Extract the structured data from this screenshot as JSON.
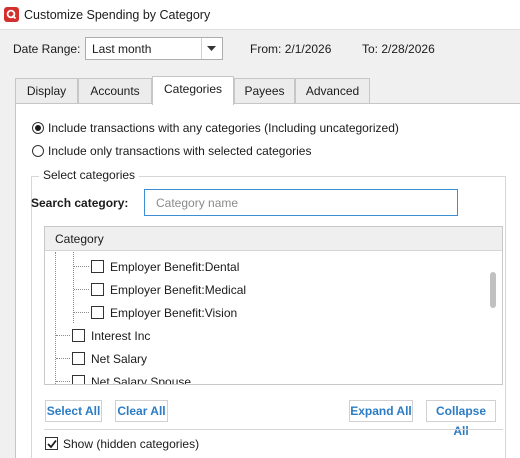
{
  "window": {
    "title": "Customize Spending by Category",
    "icon": "quicken-logo-icon"
  },
  "date_range": {
    "label": "Date Range:",
    "value": "Last month",
    "from_label": "From:",
    "from_value": "2/1/2026",
    "to_label": "To:",
    "to_value": "2/28/2026"
  },
  "tabs": [
    {
      "label": "Display",
      "active": false
    },
    {
      "label": "Accounts",
      "active": false
    },
    {
      "label": "Categories",
      "active": true
    },
    {
      "label": "Payees",
      "active": false
    },
    {
      "label": "Advanced",
      "active": false
    }
  ],
  "options": {
    "any": {
      "label": "Include transactions with any categories (Including uncategorized)",
      "selected": true
    },
    "selected": {
      "label": "Include only transactions with selected categories",
      "selected": false
    }
  },
  "select_categories": {
    "group_title": "Select categories",
    "search_label": "Search category:",
    "search_placeholder": "Category name",
    "search_value": "",
    "column_header": "Category",
    "items": [
      {
        "label": "Employer Benefit:Dental",
        "checked": false,
        "level": 2
      },
      {
        "label": "Employer Benefit:Medical",
        "checked": false,
        "level": 2
      },
      {
        "label": "Employer Benefit:Vision",
        "checked": false,
        "level": 2
      },
      {
        "label": "Interest Inc",
        "checked": false,
        "level": 1
      },
      {
        "label": "Net Salary",
        "checked": false,
        "level": 1
      },
      {
        "label": "Net Salary Spouse",
        "checked": false,
        "level": 1
      }
    ]
  },
  "buttons": {
    "select_all": "Select All",
    "clear_all": "Clear All",
    "expand_all": "Expand All",
    "collapse_all": "Collapse All"
  },
  "show_hidden": {
    "label": "Show (hidden categories)",
    "checked": true
  }
}
